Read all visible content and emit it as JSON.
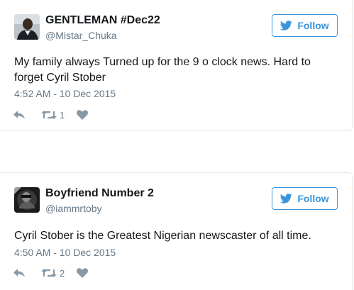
{
  "tweets": [
    {
      "display_name": "GENTLEMAN #Dec22",
      "handle": "@Mistar_Chuka",
      "follow_label": "Follow",
      "text": "My family always Turned up for the 9 o clock news. Hard to forget  Cyril Stober",
      "timestamp": "4:52 AM - 10 Dec 2015",
      "retweet_count": "1"
    },
    {
      "display_name": "Boyfriend Number 2",
      "handle": "@iammrtoby",
      "follow_label": "Follow",
      "text": "Cyril Stober is the Greatest Nigerian newscaster of all time.",
      "timestamp": "4:50 AM - 10 Dec 2015",
      "retweet_count": "2"
    }
  ],
  "colors": {
    "follow_blue": "#3b94d9",
    "meta_gray": "#657786",
    "action_gray": "#8899a6",
    "border": "#e1e8ed"
  },
  "icons": [
    "bird-icon",
    "reply-icon",
    "retweet-icon",
    "heart-icon"
  ]
}
